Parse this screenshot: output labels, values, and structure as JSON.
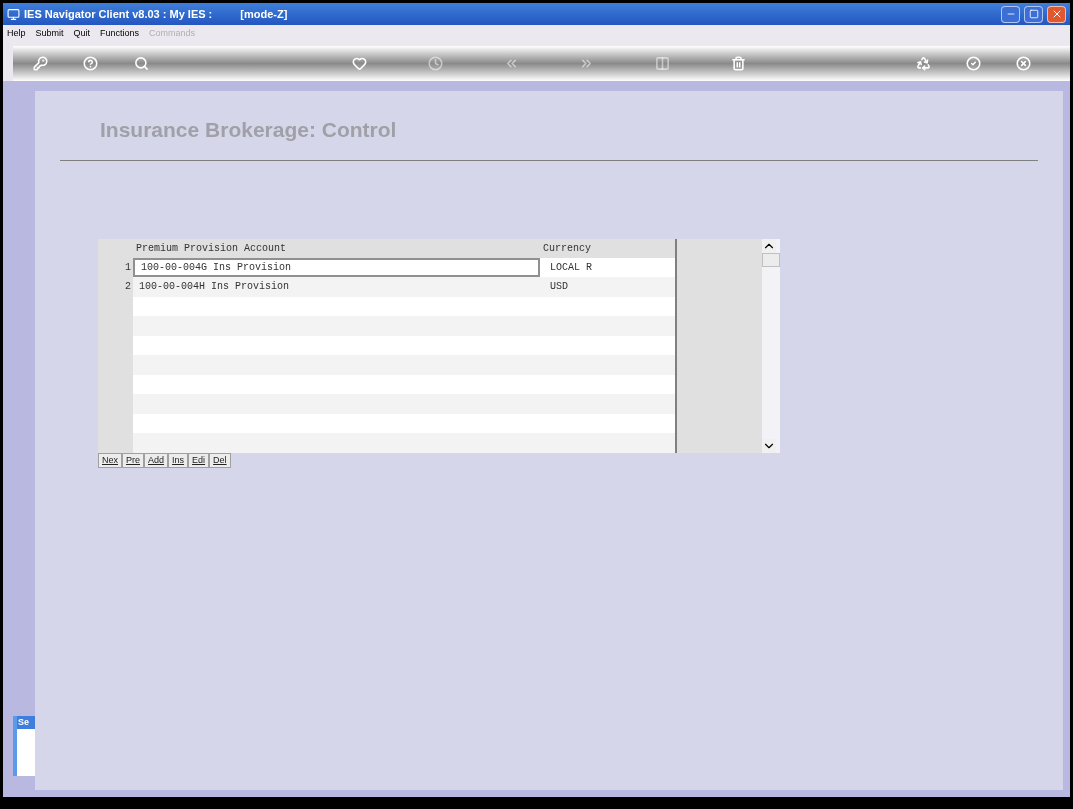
{
  "window": {
    "title": "IES Navigator Client v8.03 : My IES :",
    "mode": "[mode-Z]"
  },
  "menu": [
    {
      "label": "Help",
      "disabled": false
    },
    {
      "label": "Submit",
      "disabled": false
    },
    {
      "label": "Quit",
      "disabled": false
    },
    {
      "label": "Functions",
      "disabled": false
    },
    {
      "label": "Commands",
      "disabled": true
    }
  ],
  "toolbar": [
    {
      "kind": "key",
      "disabled": false
    },
    {
      "kind": "help",
      "disabled": false
    },
    {
      "kind": "search",
      "disabled": false
    },
    {
      "kind": "heart",
      "disabled": false
    },
    {
      "kind": "clock",
      "disabled": true
    },
    {
      "kind": "prev",
      "disabled": true
    },
    {
      "kind": "next",
      "disabled": true
    },
    {
      "kind": "columns",
      "disabled": true
    },
    {
      "kind": "trash",
      "disabled": false
    },
    {
      "kind": "recycle",
      "disabled": false
    },
    {
      "kind": "check",
      "disabled": false
    },
    {
      "kind": "cancel",
      "disabled": false
    }
  ],
  "page_title": "Insurance Brokerage: Control",
  "table": {
    "columns": [
      "Premium Provision Account",
      "Currency"
    ],
    "rows": [
      {
        "number": "1",
        "account": "100-00-004G Ins Provision",
        "currency": "LOCAL R",
        "selected": true
      },
      {
        "number": "2",
        "account": "100-00-004H Ins Provision",
        "currency": "USD",
        "selected": false
      }
    ]
  },
  "row_buttons": [
    "Nex",
    "Pre",
    "Add",
    "Ins",
    "Edi",
    "Del"
  ],
  "background_window": {
    "title": "Se"
  }
}
